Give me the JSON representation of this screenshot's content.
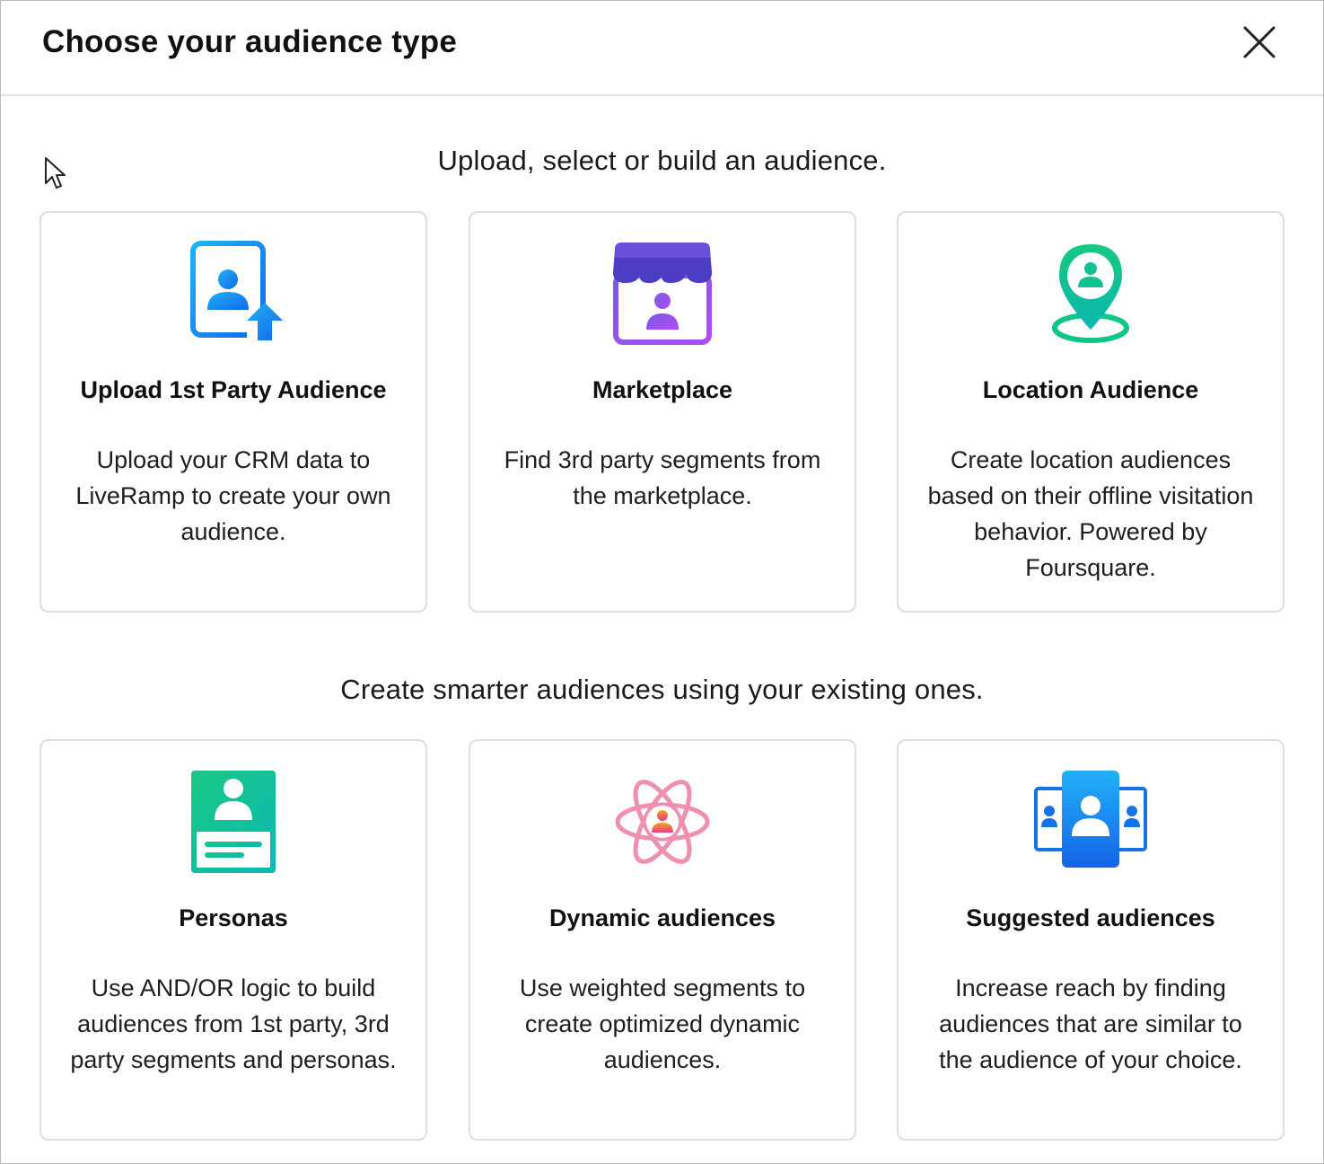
{
  "dialog": {
    "title": "Choose your audience type",
    "close_icon": "close-icon"
  },
  "sections": [
    {
      "heading": "Upload, select or build an audience.",
      "cards": [
        {
          "icon": "upload-contact-icon",
          "title": "Upload 1st Party Audience",
          "description": "Upload your CRM data to LiveRamp to create your own audience."
        },
        {
          "icon": "storefront-icon",
          "title": "Marketplace",
          "description": "Find 3rd party segments from the marketplace."
        },
        {
          "icon": "location-pin-icon",
          "title": "Location Audience",
          "description": "Create location audiences based on their offline visitation behavior. Powered by Foursquare."
        }
      ]
    },
    {
      "heading": "Create smarter audiences using your existing ones.",
      "cards": [
        {
          "icon": "persona-card-icon",
          "title": "Personas",
          "description": "Use AND/OR logic to build audiences from 1st party, 3rd party segments and personas."
        },
        {
          "icon": "atom-icon",
          "title": "Dynamic audiences",
          "description": "Use weighted segments to create optimized dynamic audiences."
        },
        {
          "icon": "suggested-people-icon",
          "title": "Suggested audiences",
          "description": "Increase reach by finding audiences that are similar to the audience of your choice."
        }
      ]
    }
  ],
  "colors": {
    "upload_blue": "#1e8bf0",
    "marketplace_purple": "#6a4fd8",
    "location_green": "#0ac690",
    "persona_teal": "#14c39b",
    "atom_pink": "#ef8fb1",
    "suggested_blue": "#1673e6"
  }
}
